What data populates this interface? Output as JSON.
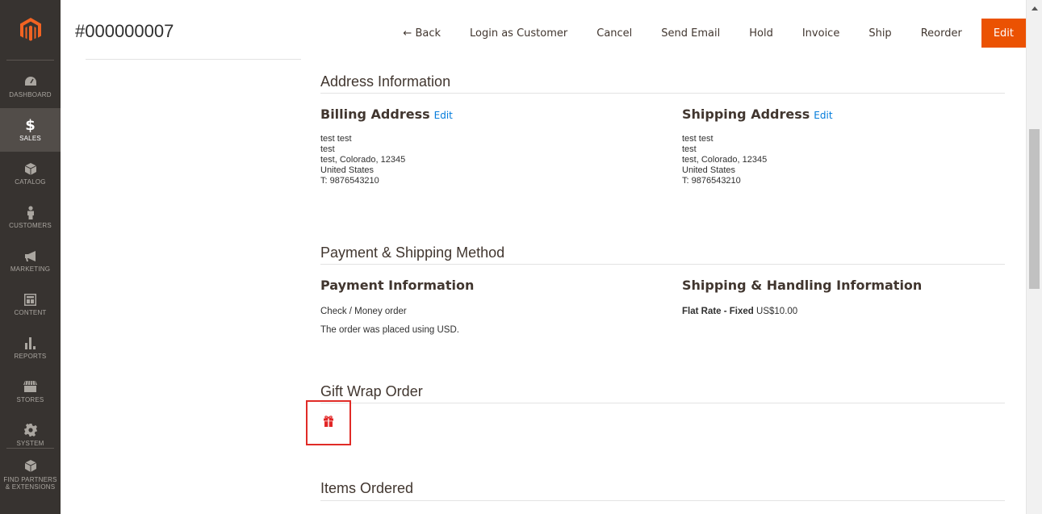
{
  "sidebar": {
    "items": [
      {
        "label": "DASHBOARD"
      },
      {
        "label": "SALES"
      },
      {
        "label": "CATALOG"
      },
      {
        "label": "CUSTOMERS"
      },
      {
        "label": "MARKETING"
      },
      {
        "label": "CONTENT"
      },
      {
        "label": "REPORTS"
      },
      {
        "label": "STORES"
      },
      {
        "label": "SYSTEM"
      },
      {
        "label": "FIND PARTNERS & EXTENSIONS"
      }
    ],
    "active": "SALES"
  },
  "header": {
    "title": "#000000007",
    "actions": {
      "back": "← Back",
      "login": "Login as Customer",
      "cancel": "Cancel",
      "send_email": "Send Email",
      "hold": "Hold",
      "invoice": "Invoice",
      "ship": "Ship",
      "reorder": "Reorder",
      "edit": "Edit"
    }
  },
  "address_info": {
    "title": "Address Information",
    "billing": {
      "title": "Billing Address",
      "edit": "Edit",
      "lines": [
        "test test",
        "test",
        "test, Colorado, 12345",
        "United States",
        "T: 9876543210"
      ]
    },
    "shipping": {
      "title": "Shipping Address",
      "edit": "Edit",
      "lines": [
        "test test",
        "test",
        "test, Colorado, 12345",
        "United States",
        "T: 9876543210"
      ]
    }
  },
  "payment_shipping": {
    "title": "Payment & Shipping Method",
    "payment": {
      "title": "Payment Information",
      "method": "Check / Money order",
      "note": "The order was placed using USD."
    },
    "shipping": {
      "title": "Shipping & Handling Information",
      "method_bold": "Flat Rate - Fixed",
      "price": "US$10.00"
    }
  },
  "gift_wrap": {
    "title": "Gift Wrap Order",
    "icon": "gift-icon"
  },
  "items_ordered": {
    "title": "Items Ordered"
  },
  "colors": {
    "sidebar_bg": "#373330",
    "accent": "#eb5202",
    "link": "#007bdb",
    "highlight": "#e02b27",
    "gift": "#e22626"
  }
}
